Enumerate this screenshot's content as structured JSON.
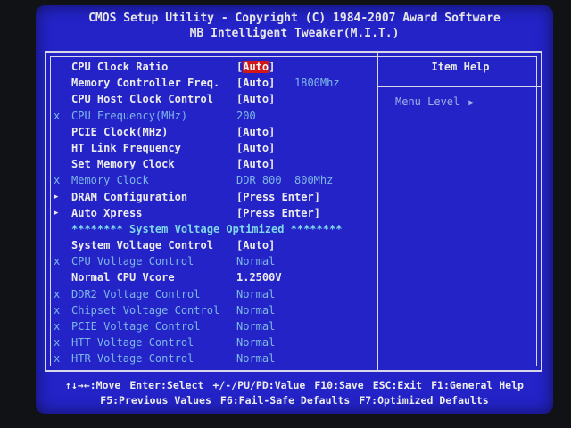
{
  "header": {
    "title_line1": "CMOS Setup Utility - Copyright (C) 1984-2007 Award Software",
    "title_line2": "MB Intelligent Tweaker(M.I.T.)"
  },
  "help": {
    "title": "Item Help",
    "menu_level": "Menu Level",
    "menu_level_arrow": "▶"
  },
  "settings": [
    {
      "mark": "",
      "label": "CPU Clock Ratio",
      "value": "[Auto]",
      "extra": ""
    },
    {
      "mark": "",
      "label": "Memory Controller Freq.",
      "value": "[Auto]",
      "extra": "1800Mhz"
    },
    {
      "mark": "",
      "label": "CPU Host Clock Control",
      "value": "[Auto]",
      "extra": ""
    },
    {
      "mark": "x",
      "label": "CPU Frequency(MHz)",
      "value": "200",
      "extra": ""
    },
    {
      "mark": "",
      "label": "PCIE Clock(MHz)",
      "value": "[Auto]",
      "extra": ""
    },
    {
      "mark": "",
      "label": "HT Link Frequency",
      "value": "[Auto]",
      "extra": ""
    },
    {
      "mark": "",
      "label": "Set Memory Clock",
      "value": "[Auto]",
      "extra": ""
    },
    {
      "mark": "x",
      "label": "Memory Clock",
      "value": "DDR 800",
      "extra": "800Mhz"
    },
    {
      "mark": "▶",
      "label": "DRAM Configuration",
      "value": "[Press Enter]",
      "extra": ""
    },
    {
      "mark": "▶",
      "label": "Auto Xpress",
      "value": "[Press Enter]",
      "extra": ""
    },
    {
      "mark": "",
      "label": "******** System Voltage Optimized ********",
      "value": "",
      "extra": ""
    },
    {
      "mark": "",
      "label": "System Voltage Control",
      "value": "[Auto]",
      "extra": ""
    },
    {
      "mark": "x",
      "label": "CPU Voltage Control",
      "value": "Normal",
      "extra": ""
    },
    {
      "mark": "",
      "label": "Normal CPU Vcore",
      "value": "1.2500V",
      "extra": ""
    },
    {
      "mark": "x",
      "label": "DDR2 Voltage Control",
      "value": "Normal",
      "extra": ""
    },
    {
      "mark": "x",
      "label": "Chipset Voltage Control",
      "value": "Normal",
      "extra": ""
    },
    {
      "mark": "x",
      "label": "PCIE Voltage Control",
      "value": "Normal",
      "extra": ""
    },
    {
      "mark": "x",
      "label": "HTT Voltage Control",
      "value": "Normal",
      "extra": ""
    },
    {
      "mark": "x",
      "label": "HTR Voltage Control",
      "value": "Normal",
      "extra": ""
    }
  ],
  "footer": {
    "line1": [
      "↑↓→←:Move",
      "Enter:Select",
      "+/-/PU/PD:Value",
      "F10:Save",
      "ESC:Exit",
      "F1:General Help"
    ],
    "line2": [
      "F5:Previous Values",
      "F6:Fail-Safe Defaults",
      "F7:Optimized Defaults"
    ]
  },
  "colors": {
    "background": "#2323c8",
    "text": "#ececec",
    "disabled": "#7fb8e6",
    "highlight": "#d01818",
    "banner": "#7fd8e8"
  }
}
